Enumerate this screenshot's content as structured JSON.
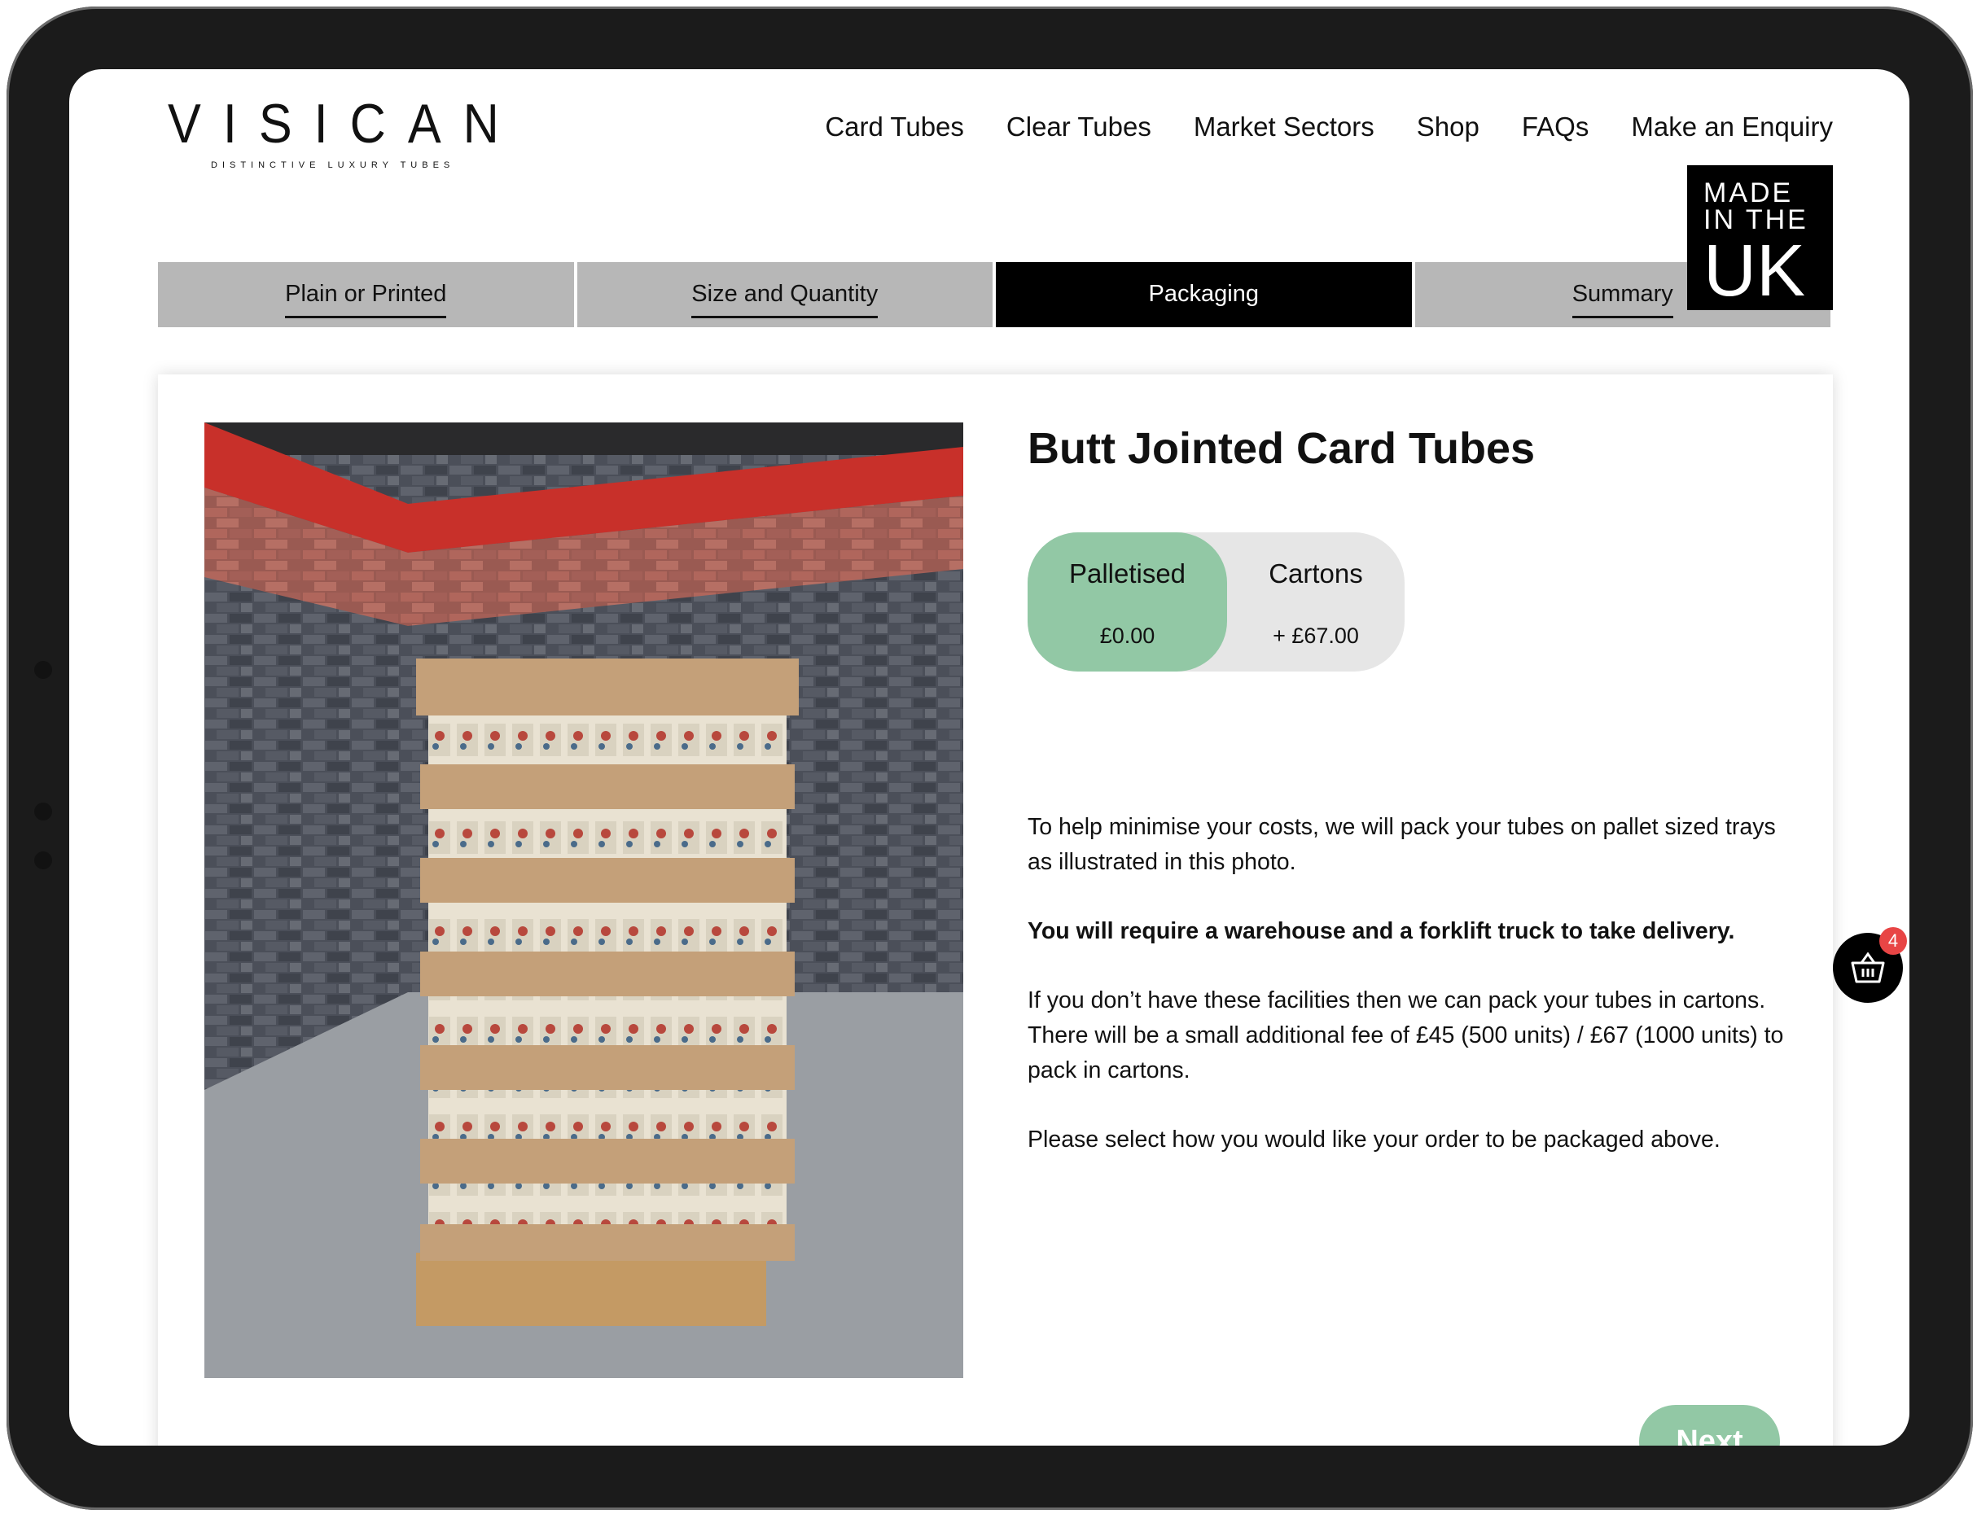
{
  "brand": {
    "name": "VISICAN",
    "tagline": "DISTINCTIVE LUXURY TUBES"
  },
  "nav": [
    "Card Tubes",
    "Clear Tubes",
    "Market Sectors",
    "Shop",
    "FAQs",
    "Make an Enquiry"
  ],
  "steps": [
    {
      "label": "Plain or Printed",
      "active": false
    },
    {
      "label": "Size and Quantity",
      "active": false
    },
    {
      "label": "Packaging",
      "active": true
    },
    {
      "label": "Summary",
      "active": false
    }
  ],
  "badge": {
    "line1": "MADE",
    "line2": "IN THE",
    "line3": "UK"
  },
  "product": {
    "title": "Butt Jointed Card Tubes"
  },
  "packaging_options": [
    {
      "name": "Palletised",
      "price": "£0.00",
      "selected": true
    },
    {
      "name": "Cartons",
      "price": "+ £67.00",
      "selected": false
    }
  ],
  "description": [
    "To help minimise your costs, we will pack your tubes on pallet sized trays as illustrated in this photo.",
    "You will require a warehouse and a forklift truck to take delivery.",
    "If you don’t have these facilities then we can pack your tubes in cartons. There will be a small additional fee of £45 (500 units) / £67 (1000 units) to pack in cartons.",
    "Please select how you would like your order to be packaged above."
  ],
  "next_label": "Next",
  "basket": {
    "count": "4",
    "icon": "basket-icon"
  },
  "colors": {
    "accent": "#92c8a5",
    "active_step": "#000000",
    "inactive_step": "#b7b7b7",
    "badge": "#e84545"
  }
}
